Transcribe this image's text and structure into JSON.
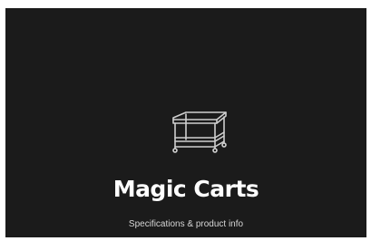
{
  "splash": {
    "logo_icon": "cart-icon",
    "title": "Magic Carts",
    "subtitle": "Specifications & product info",
    "background_color": "#1b1b1b",
    "text_color": "#ffffff"
  }
}
